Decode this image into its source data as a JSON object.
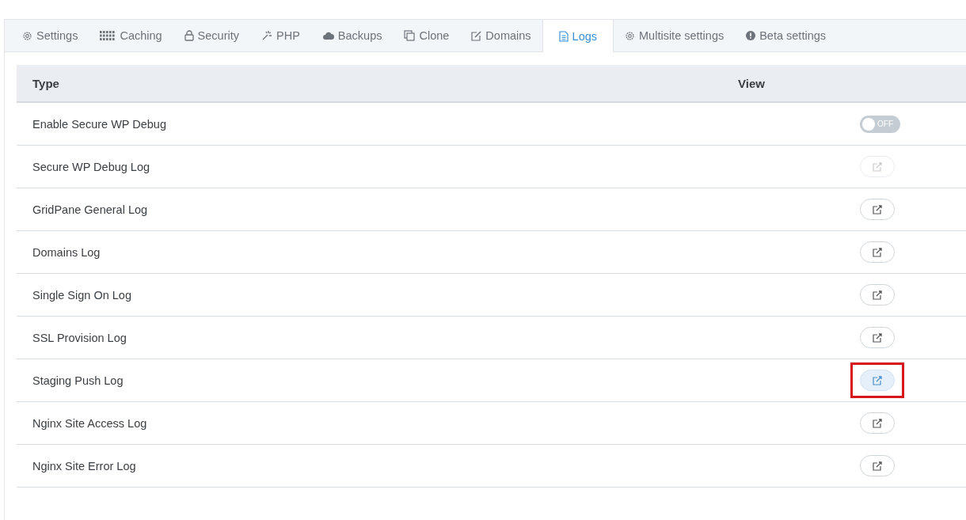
{
  "tabs": [
    {
      "label": "Settings",
      "selected": false
    },
    {
      "label": "Caching",
      "selected": false
    },
    {
      "label": "Security",
      "selected": false
    },
    {
      "label": "PHP",
      "selected": false
    },
    {
      "label": "Backups",
      "selected": false
    },
    {
      "label": "Clone",
      "selected": false
    },
    {
      "label": "Domains",
      "selected": false
    },
    {
      "label": "Logs",
      "selected": true
    },
    {
      "label": "Multisite settings",
      "selected": false
    },
    {
      "label": "Beta settings",
      "selected": false
    }
  ],
  "table": {
    "columns": [
      "Type",
      "View"
    ],
    "rows": [
      {
        "type": "Enable Secure WP Debug",
        "kind": "toggle",
        "on": false,
        "toggle_label": "OFF"
      },
      {
        "type": "Secure WP Debug Log",
        "kind": "link",
        "disabled": true,
        "highlighted": false
      },
      {
        "type": "GridPane General Log",
        "kind": "link",
        "disabled": false,
        "highlighted": false
      },
      {
        "type": "Domains Log",
        "kind": "link",
        "disabled": false,
        "highlighted": false
      },
      {
        "type": "Single Sign On Log",
        "kind": "link",
        "disabled": false,
        "highlighted": false
      },
      {
        "type": "SSL Provision Log",
        "kind": "link",
        "disabled": false,
        "highlighted": false
      },
      {
        "type": "Staging Push Log",
        "kind": "link",
        "disabled": false,
        "highlighted": true
      },
      {
        "type": "Nginx Site Access Log",
        "kind": "link",
        "disabled": false,
        "highlighted": false
      },
      {
        "type": "Nginx Site Error Log",
        "kind": "link",
        "disabled": false,
        "highlighted": false
      }
    ]
  }
}
